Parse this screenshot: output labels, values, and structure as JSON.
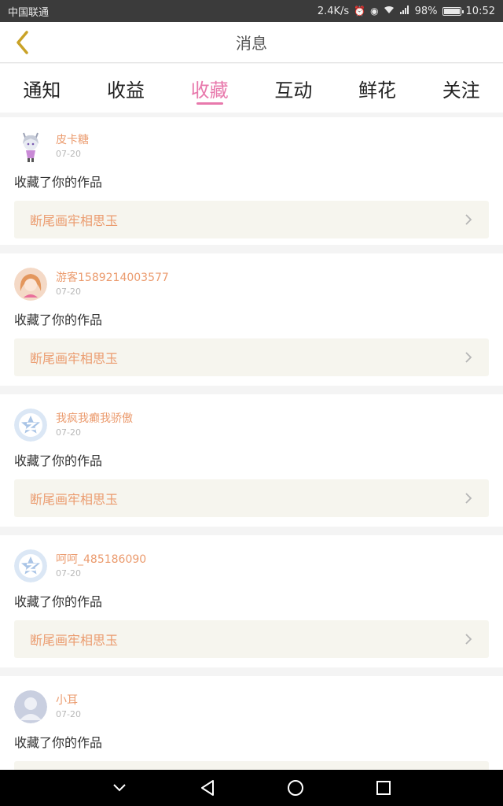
{
  "status_bar": {
    "carrier": "中国联通",
    "speed": "2.4K/s",
    "battery": "98%",
    "battery_level": 0.98,
    "time": "10:52"
  },
  "header": {
    "title": "消息",
    "accent_color": "#c9a227"
  },
  "tabs": [
    {
      "label": "通知",
      "active": false
    },
    {
      "label": "收益",
      "active": false
    },
    {
      "label": "收藏",
      "active": true
    },
    {
      "label": "互动",
      "active": false
    },
    {
      "label": "鲜花",
      "active": false
    },
    {
      "label": "关注",
      "active": false
    }
  ],
  "theme": {
    "tab_active": "#e879ac",
    "username": "#eb9b6e",
    "work_bg": "#f6f5ee"
  },
  "items": [
    {
      "username": "皮卡糖",
      "date": "07-20",
      "action": "收藏了你的作品",
      "work": "断尾画牢相思玉",
      "avatar": "anime-girl-white-hair-avatar"
    },
    {
      "username": "游客1589214003577",
      "date": "07-20",
      "action": "收藏了你的作品",
      "work": "断尾画牢相思玉",
      "avatar": "anime-girl-orange-avatar"
    },
    {
      "username": "我疯我癫我骄傲",
      "date": "07-20",
      "action": "收藏了你的作品",
      "work": "断尾画牢相思玉",
      "avatar": "default-star-avatar"
    },
    {
      "username": "呵呵_485186090",
      "date": "07-20",
      "action": "收藏了你的作品",
      "work": "断尾画牢相思玉",
      "avatar": "default-star-avatar"
    },
    {
      "username": "小耳",
      "date": "07-20",
      "action": "收藏了你的作品",
      "work": "",
      "avatar": "default-person-avatar"
    }
  ]
}
